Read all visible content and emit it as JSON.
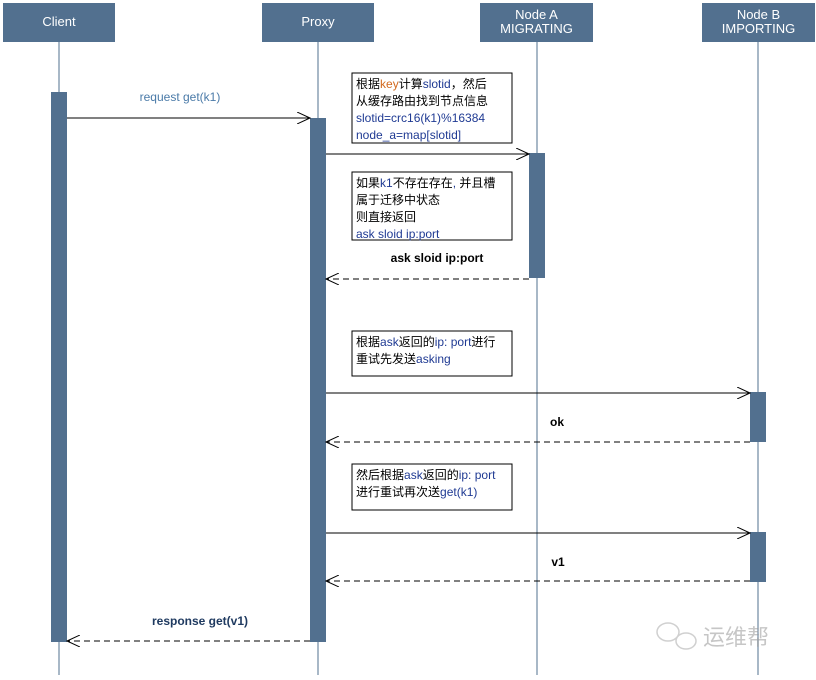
{
  "participants": [
    {
      "id": "client",
      "lines": [
        "Client"
      ]
    },
    {
      "id": "proxy",
      "lines": [
        "Proxy"
      ]
    },
    {
      "id": "node-a",
      "lines": [
        "Node A",
        "MIGRATING"
      ]
    },
    {
      "id": "node-b",
      "lines": [
        "Node B",
        "IMPORTING"
      ]
    }
  ],
  "messages": [
    {
      "from": "client",
      "to": "proxy",
      "label": "request get(k1)",
      "style": "solid"
    },
    {
      "from": "proxy",
      "to": "node-a",
      "label": "",
      "style": "solid"
    },
    {
      "from": "node-a",
      "to": "proxy",
      "label": "ask  sloid ip:port",
      "style": "dashed"
    },
    {
      "from": "proxy",
      "to": "node-b",
      "label": "",
      "style": "solid"
    },
    {
      "from": "node-b",
      "to": "proxy",
      "label": "ok",
      "style": "dashed"
    },
    {
      "from": "proxy",
      "to": "node-b",
      "label": "",
      "style": "solid"
    },
    {
      "from": "node-b",
      "to": "proxy",
      "label": "v1",
      "style": "dashed"
    },
    {
      "from": "proxy",
      "to": "client",
      "label": "response get(v1)",
      "style": "dashed"
    }
  ],
  "notes": [
    {
      "lines": [
        "根据key计算slotid，然后",
        "从缓存路由找到节点信息",
        "slotid=crc16(k1)%16384",
        "node_a=map[slotid]"
      ]
    },
    {
      "lines": [
        "如果k1不存在存在, 并且槽",
        "属于迁移中状态",
        "则直接返回",
        "ask  sloid ip:port"
      ]
    },
    {
      "lines": [
        "根据ask返回的ip: port进行",
        "重试先发送asking"
      ]
    },
    {
      "lines": [
        "然后根据ask返回的ip: port",
        "进行重试再次送get(k1)"
      ]
    }
  ],
  "watermark": "运维帮",
  "colors": {
    "header": "#52708f",
    "label_blue": "#4a7aa8",
    "ascii_text": "#1f3a93",
    "key_text": "#d2691e"
  }
}
